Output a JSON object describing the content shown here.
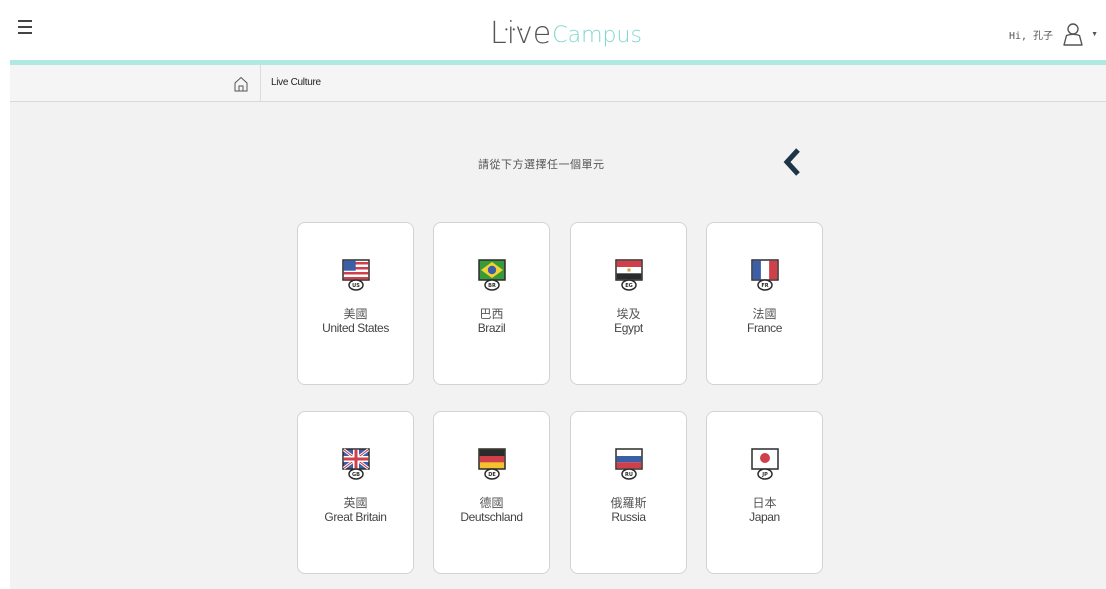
{
  "header": {
    "logo_live": "Live",
    "logo_campus": "Campus",
    "user_greeting": "Hi, 孔子"
  },
  "breadcrumb": {
    "current": "Live Culture"
  },
  "main": {
    "instruction": "請從下方選擇任一個單元"
  },
  "countries": [
    {
      "zh": "美國",
      "en": "United States",
      "code": "US"
    },
    {
      "zh": "巴西",
      "en": "Brazil",
      "code": "BR"
    },
    {
      "zh": "埃及",
      "en": "Egypt",
      "code": "EG"
    },
    {
      "zh": "法國",
      "en": "France",
      "code": "FR"
    },
    {
      "zh": "英國",
      "en": "Great Britain",
      "code": "GB"
    },
    {
      "zh": "德國",
      "en": "Deutschland",
      "code": "DE"
    },
    {
      "zh": "俄羅斯",
      "en": "Russia",
      "code": "RU"
    },
    {
      "zh": "日本",
      "en": "Japan",
      "code": "JP"
    }
  ],
  "colors": {
    "accent": "#aee9e2",
    "logo_campus": "#7fd8cc",
    "back_chevron": "#1f3447",
    "flag_frame": "#2b2b2b"
  },
  "icons": {
    "menu": "hamburger-menu-icon",
    "user": "user-icon",
    "dropdown": "caret-down-icon",
    "home": "home-icon",
    "back": "chevron-left-icon"
  }
}
